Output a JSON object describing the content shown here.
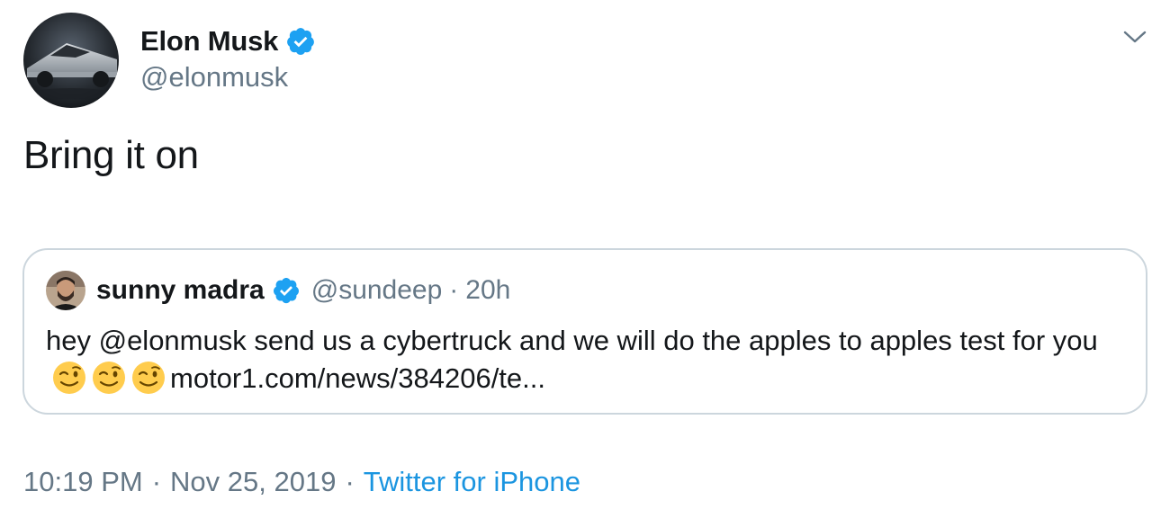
{
  "author": {
    "display_name": "Elon Musk",
    "handle": "@elonmusk",
    "verified": true,
    "avatar_icon": "cybertruck-avatar-icon"
  },
  "menu_icon": "chevron-down-icon",
  "tweet_text": "Bring it on",
  "quoted_tweet": {
    "display_name": "sunny madra",
    "handle": "@sundeep",
    "separator": "·",
    "age": "20h",
    "verified": true,
    "text_before_emoji": "hey @elonmusk send us a cybertruck and we will do the apples to apples test for you",
    "emojis": [
      "winking-face-emoji",
      "winking-face-emoji",
      "winking-face-emoji"
    ],
    "link_text": "motor1.com/news/384206/te..."
  },
  "footer": {
    "time": "10:19 PM",
    "separator": "·",
    "date": "Nov 25, 2019",
    "source": "Twitter for iPhone"
  },
  "colors": {
    "verified_blue": "#1da1f2",
    "link_blue": "#1b95e0",
    "muted_gray": "#657786",
    "border_gray": "#ccd6dd",
    "text_dark": "#14171a"
  }
}
